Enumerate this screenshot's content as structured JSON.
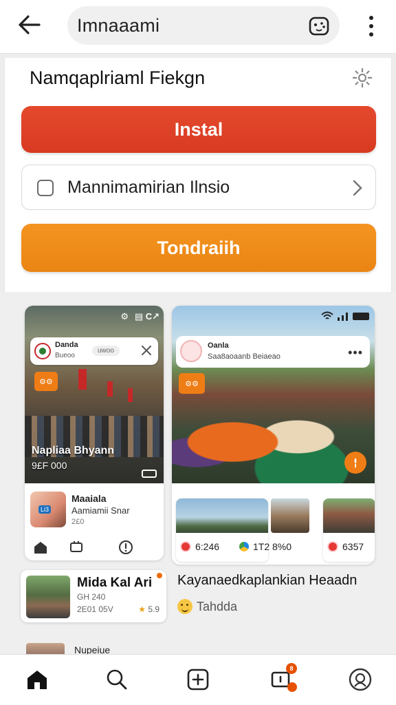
{
  "topbar": {
    "search_text": "Imnaaami"
  },
  "panel": {
    "title": "Namqaplriaml Fiekgn",
    "install_label": "Instal",
    "option_label": "Mannimamirian Ilnsio",
    "primary_label": "Tondraiih"
  },
  "feed": {
    "card1": {
      "status": "⚙   ▤ C↗",
      "notif_title": "Danda",
      "notif_sub": "Bueoo",
      "notif_chip": "uwoo",
      "badge": "⚙⚙",
      "caption": "Napliaa Bhyann",
      "caption_sub": "9£F 000",
      "author_name": "Maaiala",
      "author_line": "Aamiamii Snar",
      "author_meta": "2£0",
      "thumb_label": "Li3"
    },
    "small_card": {
      "title": "Mida Kal Ari",
      "line1": "GH 240",
      "line2": "2E01 05V",
      "rating": "5.9"
    },
    "card2": {
      "post_title": "Oanla",
      "post_sub": "Saa8aoaanb Beiaeao",
      "badge": "⚙⚙",
      "stats": [
        {
          "value": "6:246"
        },
        {
          "value": "1T2 8%0"
        },
        {
          "value": "6357"
        }
      ],
      "caption": "Kayanaedkaplankian Heaadn",
      "reaction": "Tahdda"
    },
    "peek": {
      "text": "Nupeiue"
    }
  },
  "colors": {
    "install": "#e0432a",
    "primary": "#f08c19",
    "accent_orange": "#ef7d15"
  },
  "icons": {
    "back": "arrow-left-icon",
    "game": "gamepad-icon",
    "more": "more-vertical-icon",
    "gear": "gear-icon",
    "nav": [
      "home-icon",
      "search-icon",
      "add-icon",
      "notifications-icon",
      "profile-icon"
    ]
  },
  "bottom_nav": {
    "notif_badge": "8"
  }
}
